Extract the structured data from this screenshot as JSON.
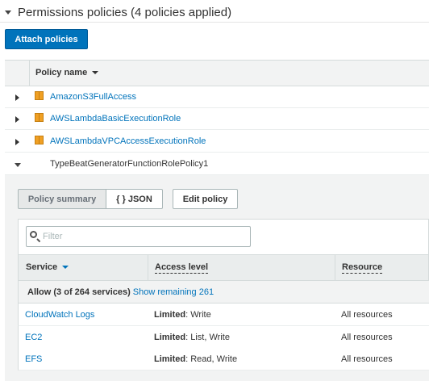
{
  "section": {
    "title": "Permissions policies (4 policies applied)",
    "attach_label": "Attach policies"
  },
  "policies_table": {
    "column_header": "Policy name",
    "rows": [
      {
        "name": "AmazonS3FullAccess",
        "type_icon": "aws-managed-policy-icon",
        "expanded": false
      },
      {
        "name": "AWSLambdaBasicExecutionRole",
        "type_icon": "aws-managed-policy-icon",
        "expanded": false
      },
      {
        "name": "AWSLambdaVPCAccessExecutionRole",
        "type_icon": "aws-managed-policy-icon",
        "expanded": false
      },
      {
        "name": "TypeBeatGeneratorFunctionRolePolicy1",
        "type_icon": "",
        "expanded": true
      }
    ]
  },
  "policy_detail": {
    "tabs": {
      "summary": "Policy summary",
      "json": "{ } JSON"
    },
    "edit_label": "Edit policy",
    "filter_placeholder": "Filter",
    "columns": {
      "service": "Service",
      "access_level": "Access level",
      "resource": "Resource"
    },
    "allow_label": "Allow (3 of 264 services)",
    "show_remaining": "Show remaining 261",
    "services": [
      {
        "service": "CloudWatch Logs",
        "level": "Limited",
        "actions": ": Write",
        "resource": "All resources"
      },
      {
        "service": "EC2",
        "level": "Limited",
        "actions": ": List, Write",
        "resource": "All resources"
      },
      {
        "service": "EFS",
        "level": "Limited",
        "actions": ": Read, Write",
        "resource": "All resources"
      }
    ]
  },
  "colors": {
    "link": "#0073bb",
    "primary_button": "#0073bb",
    "policy_icon": "#f0a024"
  }
}
